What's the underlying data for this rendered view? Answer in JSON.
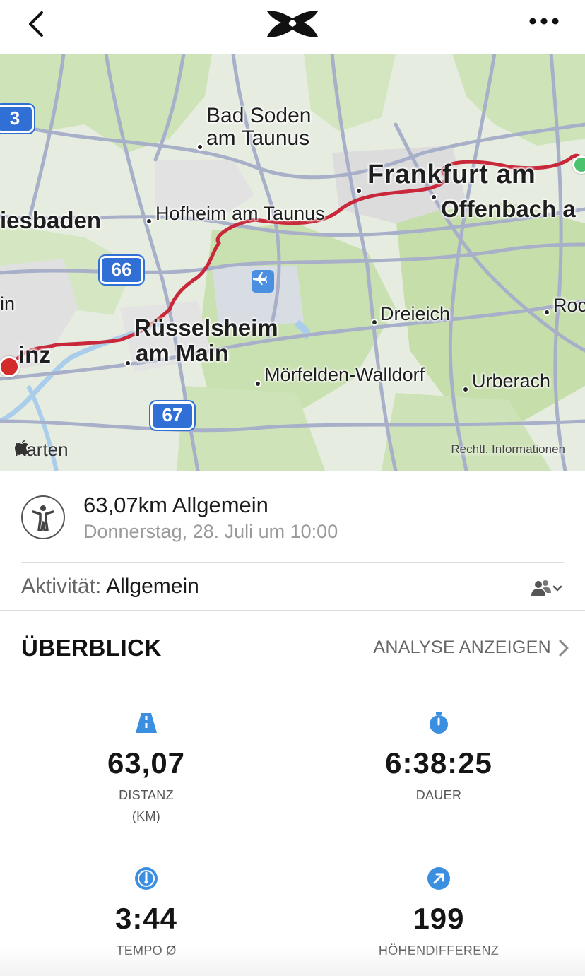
{
  "header": {
    "back_icon": "chevron-left-icon",
    "logo_icon": "under-armour-logo",
    "more_icon": "more-horizontal-icon"
  },
  "map": {
    "labels": {
      "bad_soden_1": "Bad Soden",
      "bad_soden_2": "am Taunus",
      "frankfurt": "Frankfurt am",
      "offenbach": "Offenbach a",
      "wiesbaden": "iesbaden",
      "hofheim": "Hofheim am Taunus",
      "ruesselsheim_1": "Rüsselsheim",
      "ruesselsheim_2": "am Main",
      "mainz": "inz",
      "in": "in",
      "dreieich": "Dreieich",
      "rod": "Roc",
      "moerfelden": "Mörfelden-Walldorf",
      "urberach": "Urberach"
    },
    "shields": {
      "a3": "3",
      "a66": "66",
      "a67": "67"
    },
    "attribution": "Karten",
    "legal": "Rechtl. Informationen",
    "route_color": "#c8283a",
    "start_color": "#4cc26e",
    "end_color": "#d42b2b"
  },
  "workout": {
    "icon": "person-activity-icon",
    "title": "63,07km Allgemein",
    "date": "Donnerstag, 28. Juli um 10:00"
  },
  "activity": {
    "label": "Aktivität:",
    "value": "Allgemein",
    "privacy_icon": "friends-icon"
  },
  "overview": {
    "title": "ÜBERBLICK",
    "analyse_link": "ANALYSE ANZEIGEN",
    "accent_color": "#3b8fe0",
    "stats": {
      "distance": {
        "value": "63,07",
        "label": "DISTANZ",
        "unit": "(KM)",
        "icon": "road-icon"
      },
      "duration": {
        "value": "6:38:25",
        "label": "DAUER",
        "icon": "stopwatch-icon"
      },
      "pace": {
        "value": "3:44",
        "label": "TEMPO Ø",
        "icon": "speedometer-icon"
      },
      "elevation": {
        "value": "199",
        "label": "HÖHENDIFFERENZ",
        "icon": "arrow-up-right-icon"
      }
    }
  }
}
